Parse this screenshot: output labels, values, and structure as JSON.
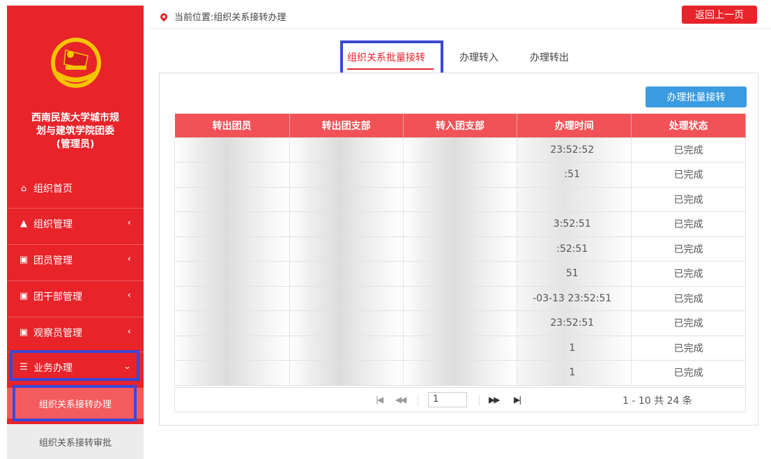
{
  "breadcrumb": {
    "label": "当前位置:组织关系接转办理"
  },
  "header": {
    "back_button": "返回上一页"
  },
  "sidebar": {
    "org_name_line1": "西南民族大学城市规",
    "org_name_line2": "划与建筑学院团委",
    "org_name_line3": "(管理员)",
    "items": [
      {
        "label": "组织首页",
        "icon": "home-icon"
      },
      {
        "label": "组织管理",
        "icon": "sitemap-icon"
      },
      {
        "label": "团员管理",
        "icon": "users-icon"
      },
      {
        "label": "团干部管理",
        "icon": "users-icon"
      },
      {
        "label": "观察员管理",
        "icon": "users-icon"
      },
      {
        "label": "业务办理",
        "icon": "list-icon"
      }
    ],
    "subitems": [
      {
        "label": "组织关系接转办理"
      },
      {
        "label": "组织关系接转审批"
      }
    ]
  },
  "tabs": [
    {
      "label": "组织关系批量接转",
      "active": true
    },
    {
      "label": "办理转入"
    },
    {
      "label": "办理转出"
    }
  ],
  "toolbar": {
    "batch_button": "办理批量接转"
  },
  "table": {
    "columns": [
      "转出团员",
      "转出团支部",
      "转入团支部",
      "办理时间",
      "处理状态"
    ],
    "rows": [
      {
        "time": "23:52:52",
        "status": "已完成"
      },
      {
        "time": ":51",
        "status": "已完成"
      },
      {
        "time": "",
        "status": "已完成"
      },
      {
        "time": "3:52:51",
        "status": "已完成"
      },
      {
        "time": ":52:51",
        "status": "已完成"
      },
      {
        "time": "51",
        "status": "已完成"
      },
      {
        "time": "-03-13 23:52:51",
        "status": "已完成"
      },
      {
        "time": "23:52:51",
        "status": "已完成"
      },
      {
        "time": "1",
        "status": "已完成"
      },
      {
        "time": "1",
        "status": "已完成"
      }
    ]
  },
  "pager": {
    "page": "1",
    "info": "1 - 10  共 24 条"
  },
  "colors": {
    "brand_red": "#e8232a",
    "header_red": "#f05257",
    "blue": "#3a9be0",
    "highlight_blue": "#3b48d8"
  }
}
